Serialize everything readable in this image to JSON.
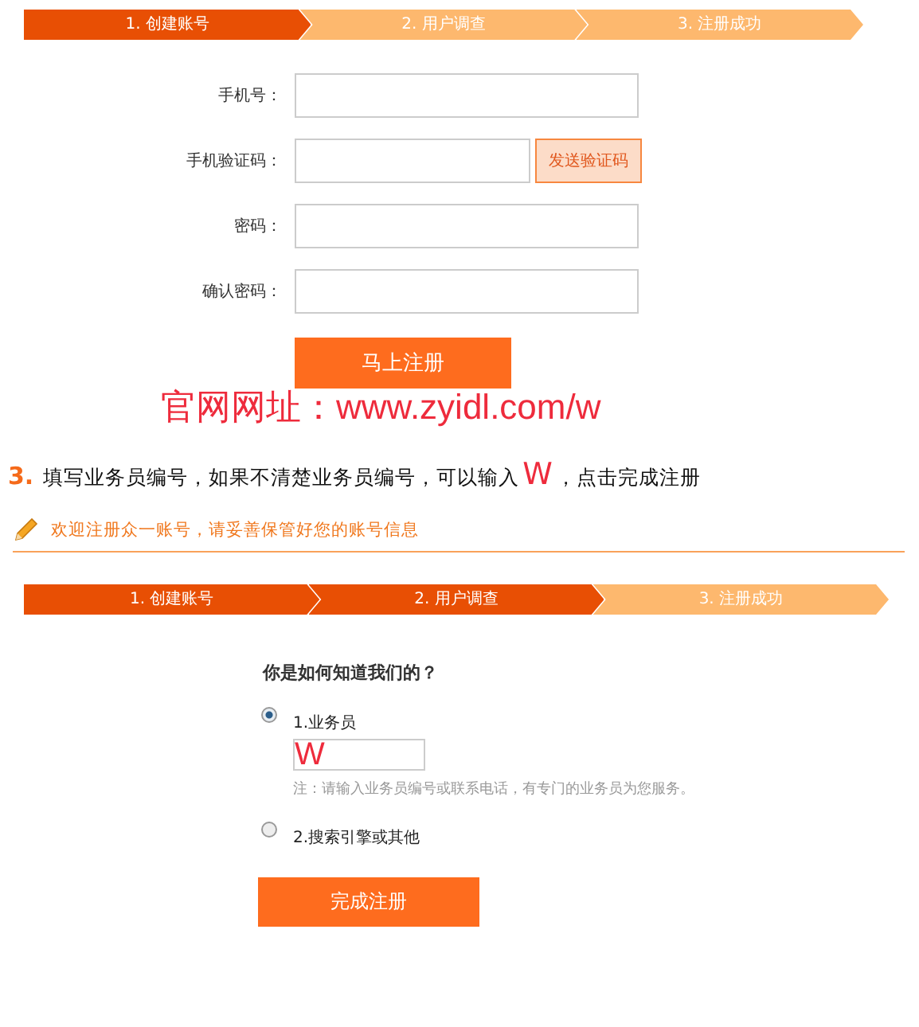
{
  "steps_top": [
    {
      "label": "1. 创建账号",
      "active": true
    },
    {
      "label": "2. 用户调查",
      "active": false
    },
    {
      "label": "3. 注册成功",
      "active": false
    }
  ],
  "form": {
    "fields": [
      {
        "label": "手机号：",
        "kind": "text"
      },
      {
        "label": "手机验证码：",
        "kind": "code",
        "button": "发送验证码"
      },
      {
        "label": "密码：",
        "kind": "text"
      },
      {
        "label": "确认密码：",
        "kind": "text"
      }
    ],
    "submit": "马上注册"
  },
  "site_note": "官网网址：www.zyidl.com/w",
  "instruction": {
    "number": "3.",
    "text_before": "填写业务员编号，如果不清楚业务员编号，可以输入",
    "mark": "W",
    "text_after": "，点击完成注册"
  },
  "welcome": "欢迎注册众一账号，请妥善保管好您的账号信息",
  "steps_bottom": [
    {
      "label": "1. 创建账号",
      "active": true
    },
    {
      "label": "2. 用户调查",
      "active": true
    },
    {
      "label": "3. 注册成功",
      "active": false
    }
  ],
  "survey": {
    "question": "你是如何知道我们的？",
    "options": [
      {
        "label": "1.业务员",
        "selected": true,
        "value": "W",
        "note": "注：请输入业务员编号或联系电话，有专门的业务员为您服务。"
      },
      {
        "label": "2.搜索引擎或其他",
        "selected": false
      }
    ],
    "submit": "完成注册"
  }
}
